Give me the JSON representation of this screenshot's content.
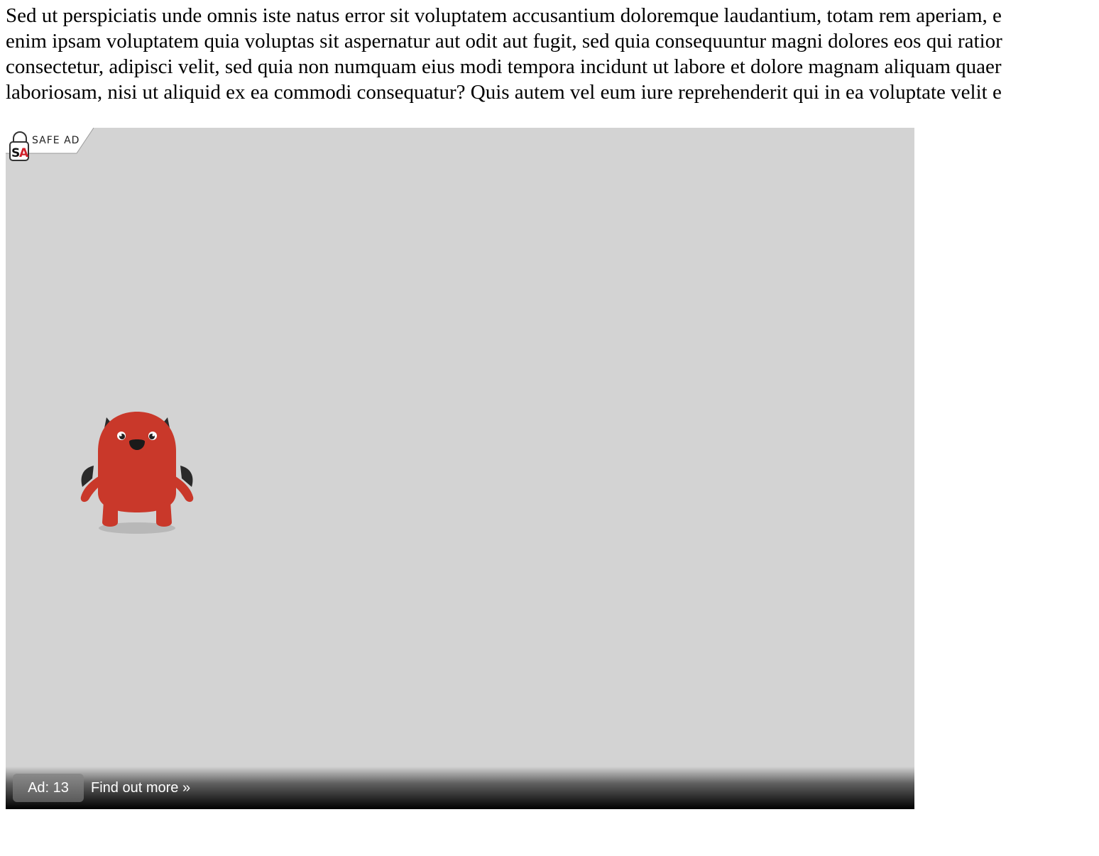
{
  "article": {
    "lines": [
      "Sed ut perspiciatis unde omnis iste natus error sit voluptatem accusantium doloremque laudantium, totam rem aperiam, e",
      "enim ipsam voluptatem quia voluptas sit aspernatur aut odit aut fugit, sed quia consequuntur magni dolores eos qui ratior",
      "consectetur, adipisci velit, sed quia non numquam eius modi tempora incidunt ut labore et dolore magnam aliquam quaer",
      "laboriosam, nisi ut aliquid ex ea commodi consequatur? Quis autem vel eum iure reprehenderit qui in ea voluptate velit e"
    ]
  },
  "ad_player": {
    "badge": {
      "logo_text": "SA",
      "label": "SAFE AD",
      "icon": "padlock-icon"
    },
    "mascot": {
      "icon": "red-devil-mascot"
    },
    "controls": {
      "ad_counter": "Ad: 13",
      "find_out_more": "Find out more »"
    },
    "colors": {
      "background": "#d3d3d3",
      "mascot_red": "#c9382a",
      "logo_red": "#d0202a"
    }
  }
}
